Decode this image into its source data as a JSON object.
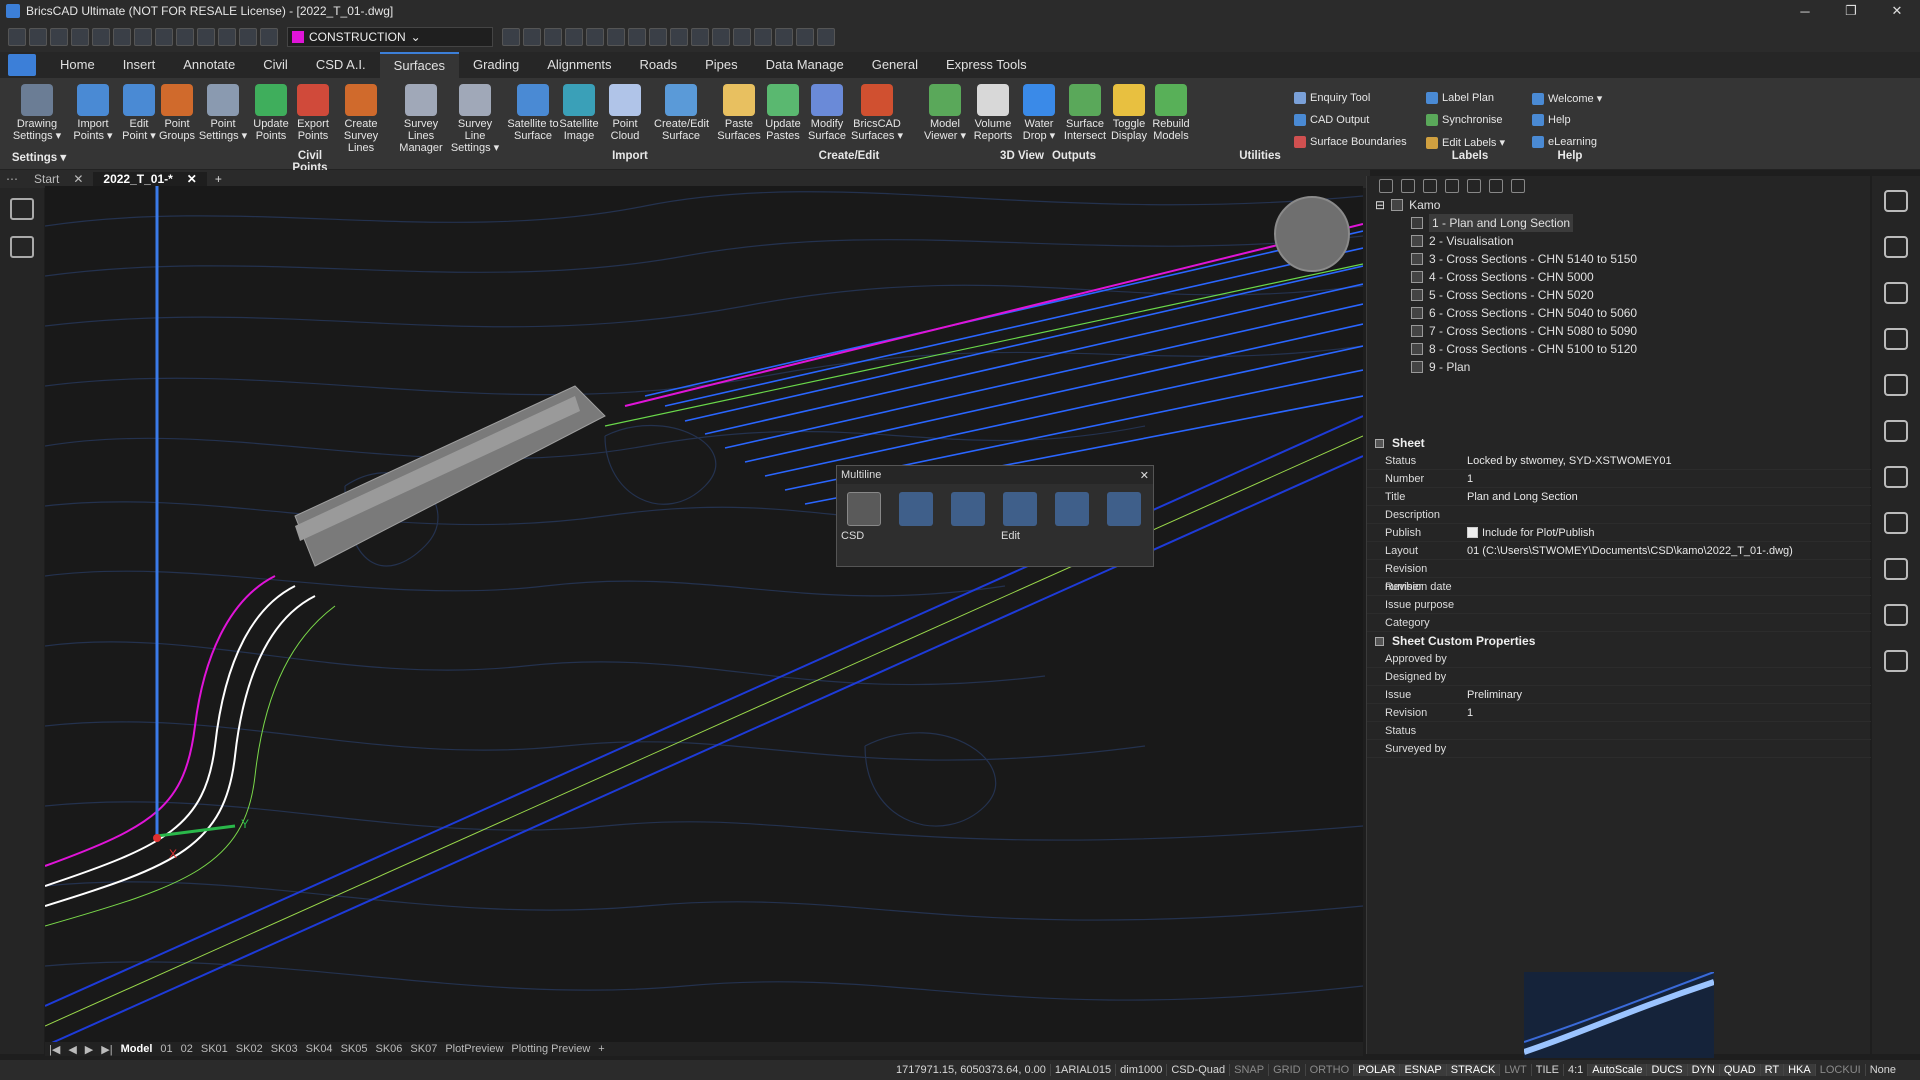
{
  "window": {
    "title": "BricsCAD Ultimate (NOT FOR RESALE License) - [2022_T_01-.dwg]",
    "minimize": "─",
    "maximize": "❐",
    "close": "✕"
  },
  "workspace": "CONSTRUCTION",
  "menu_tabs": [
    "Home",
    "Insert",
    "Annotate",
    "Civil",
    "CSD A.I.",
    "Surfaces",
    "Grading",
    "Alignments",
    "Roads",
    "Pipes",
    "Data Manage",
    "General",
    "Express Tools"
  ],
  "active_tab": "Surfaces",
  "ribbon": {
    "buttons": [
      {
        "label": "Drawing\nSettings ▾",
        "color": "#6b7d95"
      },
      {
        "label": "Import\nPoints ▾",
        "color": "#4a8ad4"
      },
      {
        "label": "Edit\nPoint ▾",
        "color": "#4a8ad4"
      },
      {
        "label": "Point\nGroups",
        "color": "#d06a2c"
      },
      {
        "label": "Point\nSettings ▾",
        "color": "#8a9ab0"
      },
      {
        "label": "Update\nPoints",
        "color": "#3fae5c"
      },
      {
        "label": "Export\nPoints",
        "color": "#d04a3a"
      },
      {
        "label": "Create\nSurvey Lines",
        "color": "#d06a2c"
      },
      {
        "label": "Survey Lines\nManager",
        "color": "#a0a8b8"
      },
      {
        "label": "Survey Line\nSettings ▾",
        "color": "#a0a8b8"
      },
      {
        "label": "Satellite to\nSurface",
        "color": "#4a8ad4"
      },
      {
        "label": "Satellite\nImage",
        "color": "#3aa0b8"
      },
      {
        "label": "Point\nCloud",
        "color": "#b0c4e8"
      },
      {
        "label": "Create/Edit\nSurface",
        "color": "#5a9ad8"
      },
      {
        "label": "Paste\nSurfaces",
        "color": "#e8c060"
      },
      {
        "label": "Update\nPastes",
        "color": "#5ab870"
      },
      {
        "label": "Modify\nSurface",
        "color": "#6a8ad8"
      },
      {
        "label": "BricsCAD\nSurfaces ▾",
        "color": "#d05030"
      },
      {
        "label": "Model\nViewer ▾",
        "color": "#5aa85a"
      },
      {
        "label": "Volume\nReports",
        "color": "#d8d8d8"
      },
      {
        "label": "Water\nDrop ▾",
        "color": "#3a8ae8"
      },
      {
        "label": "Surface\nIntersect",
        "color": "#5aa85a"
      },
      {
        "label": "Toggle\nDisplay",
        "color": "#e8c040"
      },
      {
        "label": "Rebuild\nModels",
        "color": "#58b058"
      }
    ],
    "small_buttons": [
      {
        "label": "Enquiry Tool",
        "color": "#7aa0d8"
      },
      {
        "label": "CAD Output",
        "color": "#4a8ad4"
      },
      {
        "label": "Surface Boundaries",
        "color": "#d05050"
      },
      {
        "label": "Label Plan",
        "color": "#4a8ad4"
      },
      {
        "label": "Synchronise",
        "color": "#5aa85a"
      },
      {
        "label": "Edit Labels ▾",
        "color": "#d0a040"
      },
      {
        "label": "Welcome ▾",
        "color": "#4a8ad4"
      },
      {
        "label": "Help",
        "color": "#4a8ad4"
      },
      {
        "label": "eLearning",
        "color": "#4a8ad4"
      }
    ],
    "groups": [
      "Settings ▾",
      "Civil Points",
      "Import",
      "Create/Edit",
      "3D View",
      "Outputs",
      "Utilities",
      "Labels",
      "Help"
    ]
  },
  "doc_tabs": [
    {
      "label": "Start",
      "close": "✕"
    },
    {
      "label": "2022_T_01-*",
      "close": "✕"
    }
  ],
  "doc_add": "+",
  "popup": {
    "title": "Multiline",
    "close": "✕",
    "labels": [
      "CSD",
      "Edit"
    ],
    "icons": [
      "on-off-layer-icon",
      "on-off-surface-icon",
      "sheet-icon",
      "update-surface-icon",
      "edit-tools-icon",
      "light-surface-icon"
    ]
  },
  "sheet_tree": {
    "root": "Kamo",
    "items": [
      "1 - Plan and Long Section",
      "2 - Visualisation",
      "3 - Cross Sections - CHN 5140 to 5150",
      "4 - Cross Sections - CHN 5000",
      "5 - Cross Sections - CHN 5020",
      "6 - Cross Sections - CHN 5040 to 5060",
      "7 - Cross Sections - CHN 5080 to 5090",
      "8 - Cross Sections - CHN 5100 to 5120",
      "9 - Plan"
    ]
  },
  "sheet_props": {
    "header": "Sheet",
    "rows": [
      {
        "k": "Status",
        "v": "Locked by stwomey, SYD-XSTWOMEY01"
      },
      {
        "k": "Number",
        "v": "1"
      },
      {
        "k": "Title",
        "v": "Plan and Long Section"
      },
      {
        "k": "Description",
        "v": ""
      },
      {
        "k": "Publish",
        "v": "Include for Plot/Publish"
      },
      {
        "k": "Layout",
        "v": "01 (C:\\Users\\STWOMEY\\Documents\\CSD\\kamo\\2022_T_01-.dwg)"
      },
      {
        "k": "Revision number",
        "v": ""
      },
      {
        "k": "Revision date",
        "v": ""
      },
      {
        "k": "Issue purpose",
        "v": ""
      },
      {
        "k": "Category",
        "v": ""
      }
    ]
  },
  "custom_props": {
    "header": "Sheet Custom Properties",
    "rows": [
      {
        "k": "Approved by",
        "v": ""
      },
      {
        "k": "Designed by",
        "v": ""
      },
      {
        "k": "Issue",
        "v": "Preliminary"
      },
      {
        "k": "Revision",
        "v": "1"
      },
      {
        "k": "Status",
        "v": ""
      },
      {
        "k": "Surveyed by",
        "v": ""
      }
    ]
  },
  "layout_tabs": [
    "Model",
    "01",
    "02",
    "SK01",
    "SK02",
    "SK03",
    "SK04",
    "SK05",
    "SK06",
    "SK07",
    "PlotPreview",
    "Plotting Preview",
    "+"
  ],
  "layout_nav": [
    "|◀",
    "◀",
    "▶",
    "▶|"
  ],
  "status_bar": {
    "coords": "1717971.15, 6050373.64, 0.00",
    "items": [
      {
        "t": "1ARIAL015",
        "s": "n"
      },
      {
        "t": "dim1000",
        "s": "n"
      },
      {
        "t": "CSD-Quad",
        "s": "n"
      },
      {
        "t": "SNAP",
        "s": "off"
      },
      {
        "t": "GRID",
        "s": "off"
      },
      {
        "t": "ORTHO",
        "s": "off"
      },
      {
        "t": "POLAR",
        "s": "on"
      },
      {
        "t": "ESNAP",
        "s": "on"
      },
      {
        "t": "STRACK",
        "s": "on"
      },
      {
        "t": "LWT",
        "s": "off"
      },
      {
        "t": "TILE",
        "s": "n"
      },
      {
        "t": "4:1",
        "s": "n"
      },
      {
        "t": "AutoScale",
        "s": "on"
      },
      {
        "t": "DUCS",
        "s": "on"
      },
      {
        "t": "DYN",
        "s": "on"
      },
      {
        "t": "QUAD",
        "s": "on"
      },
      {
        "t": "RT",
        "s": "on"
      },
      {
        "t": "HKA",
        "s": "on"
      },
      {
        "t": "LOCKUI",
        "s": "off"
      },
      {
        "t": "None",
        "s": "n"
      }
    ]
  },
  "ucs": {
    "x": "X",
    "y": "Y"
  },
  "colors": {
    "accent": "#3c7fd8",
    "contour": "#2a3a5a",
    "road_blue": "#2a66ff",
    "magenta": "#e014d8"
  }
}
